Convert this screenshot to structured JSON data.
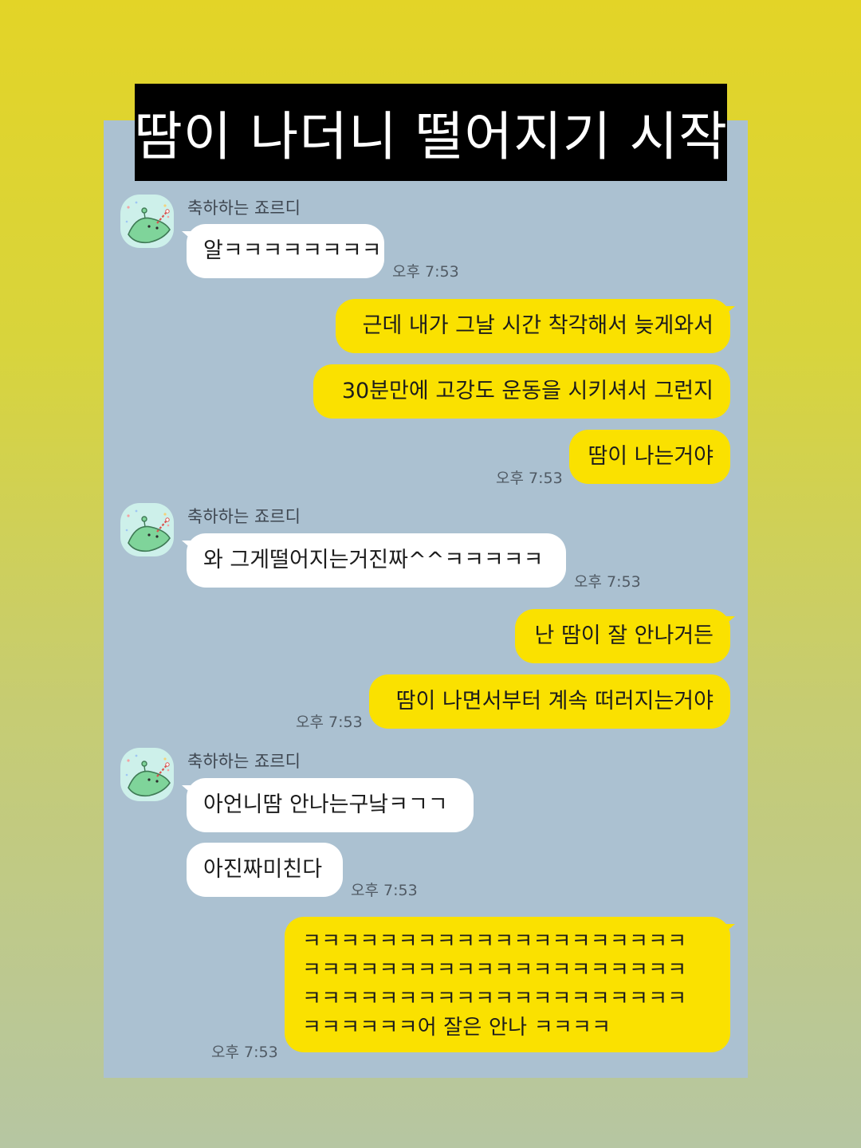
{
  "title": "땀이 나더니 떨어지기 시작",
  "chat": {
    "sender_name": "축하하는 죠르디",
    "avatar_icon": "jordy-dinosaur-icon",
    "colors": {
      "background": "#abc1d1",
      "outgoing": "#fae100",
      "incoming": "#ffffff"
    },
    "messages": [
      {
        "from": "other",
        "text": "알ㅋㅋㅋㅋㅋㅋㅋㅋ",
        "time": "오후 7:53"
      },
      {
        "from": "me",
        "text": "근데 내가 그날 시간 착각해서 늦게와서"
      },
      {
        "from": "me",
        "text": "30분만에 고강도 운동을 시키셔서 그런지"
      },
      {
        "from": "me",
        "text": "땀이 나는거야",
        "time": "오후 7:53"
      },
      {
        "from": "other",
        "text": "와 그게떨어지는거진짜^^ㅋㅋㅋㅋㅋ",
        "time": "오후 7:53"
      },
      {
        "from": "me",
        "text": "난 땀이 잘 안나거든"
      },
      {
        "from": "me",
        "text": "땀이 나면서부터 계속 떠러지는거야",
        "time": "오후 7:53"
      },
      {
        "from": "other",
        "text": "아언니땀 안나는구낰ㅋㄱㄱ"
      },
      {
        "from": "other",
        "text": "아진짜미친다",
        "time": "오후 7:53"
      },
      {
        "from": "me",
        "text": "ㅋㅋㅋㅋㅋㅋㅋㅋㅋㅋㅋㅋㅋㅋㅋㅋㅋㅋㅋㅋ\nㅋㅋㅋㅋㅋㅋㅋㅋㅋㅋㅋㅋㅋㅋㅋㅋㅋㅋㅋㅋ\nㅋㅋㅋㅋㅋㅋㅋㅋㅋㅋㅋㅋㅋㅋㅋㅋㅋㅋㅋㅋ\nㅋㅋㅋㅋㅋㅋ어 잘은 안나 ㅋㅋㅋㅋ",
        "time": "오후 7:53"
      }
    ]
  }
}
